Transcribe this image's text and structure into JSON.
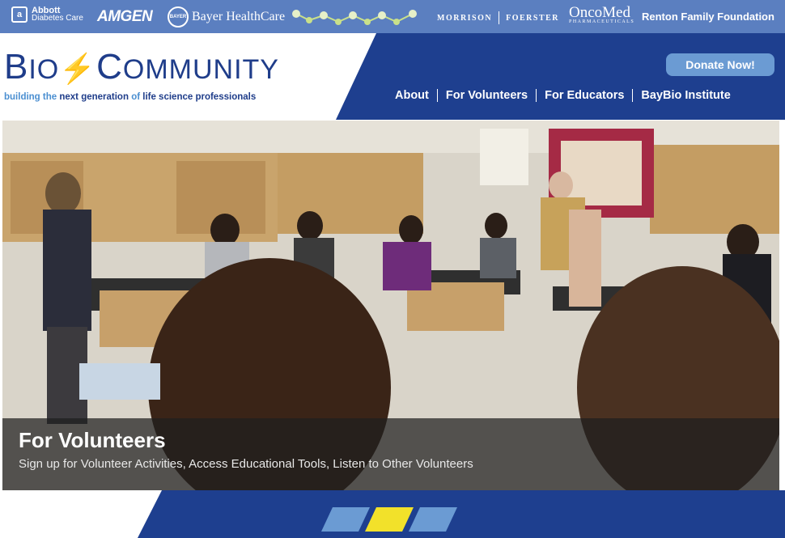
{
  "sponsors": {
    "abbott_name": "Abbott",
    "abbott_sub": "Diabetes Care",
    "amgen": "AMGEN",
    "bayer": "Bayer HealthCare",
    "bayer_mark": "BAYER",
    "biolink": "biolink",
    "morrison": "MORRISON",
    "foerster": "FOERSTER",
    "oncomed": "OncoMed",
    "oncomed_sub": "PHARMACEUTICALS",
    "renton": "Renton Family Foundation"
  },
  "logo": {
    "title_big_b": "B",
    "title_io": "IO",
    "title_big_c": "C",
    "title_ommunity": "OMMUNITY",
    "tagline_1": "building the ",
    "tagline_2": "next generation",
    "tagline_3": " of ",
    "tagline_4": "life science professionals"
  },
  "header": {
    "donate_label": "Donate Now!",
    "nav": [
      "About",
      "For Volunteers",
      "For Educators",
      "BayBio Institute"
    ]
  },
  "hero": {
    "title": "For Volunteers",
    "subtitle": "Sign up for Volunteer Activities, Access Educational Tools, Listen to Other Volunteers"
  },
  "pager": {
    "count": 3,
    "active_index": 1,
    "active_color": "#f2e12a",
    "inactive_color": "#6b9bd3"
  },
  "colors": {
    "brand_navy": "#1e3f8f",
    "sponsor_bar": "#5b7fc0",
    "accent_blue": "#4b8fd1"
  }
}
